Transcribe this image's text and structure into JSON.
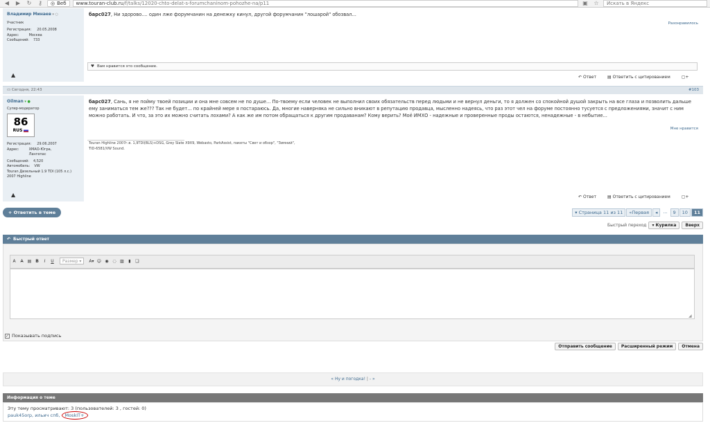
{
  "browser": {
    "web_label": "Веб",
    "url_host": "www.touran-club.ru",
    "url_path": "/f/talks/12020-chto-delat-s-forumchaninom-pohozhe-na/p11",
    "search_placeholder": "Искать в Яндекс"
  },
  "post1": {
    "author": "Владимир Минаев",
    "role": "Участник",
    "reg_label": "Регистрация:",
    "reg_value": "20.05.2008",
    "addr_label": "Адрес:",
    "addr_value": "Москва",
    "msgs_label": "Сообщений:",
    "msgs_value": "733",
    "quote_name": "барс027",
    "text": ", Ни здорово.... один лже форумчанин на денежку кинул, другой форумчанин \"лошарой\" обозвал...",
    "unlike": "Разонравилось",
    "like_note": "Вам нравится это сообщение.",
    "reply": "Ответ",
    "reply_quote": "Ответить с цитированием"
  },
  "post2": {
    "date": "Сегодня, 22:43",
    "num": "#103",
    "author": "Oilman",
    "role": "Супер-модератор",
    "plate_num": "86",
    "plate_code": "RUS",
    "reg_label": "Регистрация:",
    "reg_value": "29.06.2007",
    "addr_label": "Адрес:",
    "addr_value": "ХМАО-Югра, Лангепас",
    "msgs_label": "Сообщений:",
    "msgs_value": "4,520",
    "cars_label": "Автомобиль:",
    "cars_value": "VW",
    "car_desc": "Touran Дизельный 1.9 TDI (105 л.с.) 2007  Highline",
    "quote_name": "барс027",
    "text": ", Сань, я не пойму твоей позиции и она мне совсем не по душе... По-твоему если человек не выполнил своих обязательств перед людьми и не вернул деньги, то я должен со спокойной душой закрыть на все глаза и позволить дальше ему заниматься тем же??? Так не будет... по крайней мере я постараюсь. Да, многие наверняка не сильно вникают в репутацию продавца, мысленно надеясь, что раз этот чел на форуме постоянно тусуется с предложениями, значит с ним можно работать. И что, за это их можно считать лохами? А как же им потом обращаться к другим продаванам? Кому верить? Моё ИМХО - надежные и проверенные проды остаются, ненадежные - в небытие...",
    "like": "Мне нравится",
    "sig1": "Touran Highline 2007г.в. 1,9TDI(BLS)+DSG, Grey Slate X9X9, Webasto, ParkAssist, пакеты \"Свет и обзор\", \"Зимний\",",
    "sig2": "TID-6581/VW Sound.",
    "reply": "Ответ",
    "reply_quote": "Ответить с цитированием"
  },
  "nav": {
    "reply_thread": "+ Ответить в теме",
    "page_info": "▾ Страница 11 из 11",
    "first": "«Первая",
    "prev": "◂",
    "dots": "...",
    "pages": [
      "9",
      "10",
      "11"
    ],
    "jump_label": "Быстрый переход",
    "jump_value": "▾ Курилка",
    "top": "Вверх"
  },
  "quick": {
    "title": "Быстрый ответ",
    "size_placeholder": "Размер",
    "show_sig": "Показывать подпись",
    "send": "Отправить сообщение",
    "advanced": "Расширенный режим",
    "cancel": "Отмена"
  },
  "bottom_nav": {
    "prev_link": "« Ну и погодка!",
    "sep": "|",
    "next_link": "- »"
  },
  "info": {
    "title": "Информация о теме",
    "viewers": "Эту тему просматривают: 3 (пользователей: 3 , гостей: 0)",
    "user1": "pauk45orp",
    "user2": "ильич спб",
    "user3": "MoskIT+"
  }
}
